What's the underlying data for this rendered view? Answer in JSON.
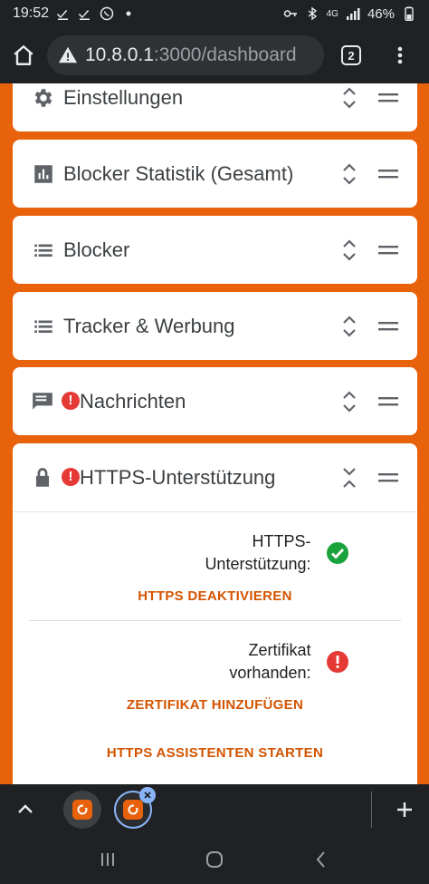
{
  "status_bar": {
    "time": "19:52",
    "battery": "46%",
    "network": "4G"
  },
  "browser": {
    "url_host": "10.8.0.1",
    "url_path": ":3000/dashboard",
    "tab_count": "2"
  },
  "cards": [
    {
      "title": "Einstellungen",
      "icon": "gear-icon"
    },
    {
      "title": "Blocker Statistik (Gesamt)",
      "icon": "bar-chart-icon"
    },
    {
      "title": "Blocker",
      "icon": "list-icon"
    },
    {
      "title": "Tracker & Werbung",
      "icon": "list-icon"
    },
    {
      "title": "Nachrichten",
      "icon": "message-icon"
    },
    {
      "title": "HTTPS-Unterstützung",
      "icon": "lock-icon"
    }
  ],
  "https_panel": {
    "https_status_label_line1": "HTTPS-",
    "https_status_label_line2": "Unterstützung:",
    "https_action": "HTTPS DEAKTIVIEREN",
    "cert_status_label_line1": "Zertifikat",
    "cert_status_label_line2": "vorhanden:",
    "cert_action": "ZERTIFIKAT HINZUFÜGEN",
    "wizard_action": "HTTPS ASSISTENTEN STARTEN"
  },
  "colors": {
    "page_background": "#e8620c",
    "link": "#d35400",
    "success": "#1aa33c",
    "error": "#e53935"
  }
}
